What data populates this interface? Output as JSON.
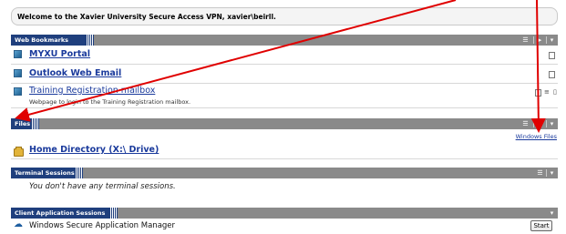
{
  "welcome": {
    "text": "Welcome to the Xavier University Secure Access VPN, xavier\\beirll."
  },
  "web_bookmarks": {
    "title": "Web Bookmarks",
    "items": [
      {
        "label": "MYXU Portal"
      },
      {
        "label": "Outlook Web Email"
      },
      {
        "label": "Training Registration mailbox",
        "description": "Webpage to login to the Training Registration mailbox."
      }
    ]
  },
  "files": {
    "title": "Files",
    "windows_files_link": "Windows Files",
    "items": [
      {
        "label": "Home Directory (X:\\ Drive)"
      }
    ]
  },
  "terminal_sessions": {
    "title": "Terminal Sessions",
    "empty_message": "You don't have any terminal sessions."
  },
  "client_app_sessions": {
    "title": "Client Application Sessions",
    "items": [
      {
        "label": "Windows Secure Application Manager",
        "button": "Start"
      }
    ]
  },
  "colors": {
    "header_tab": "#1f3f7d",
    "header_bar": "#8a8a8a",
    "link": "#1a3a9c",
    "annotation_arrow": "#e00000"
  },
  "icons": {
    "bookmark": "web-bookmark-icon",
    "folder": "folder-icon",
    "client_app": "application-manager-icon",
    "header_controls": [
      "list-menu-icon",
      "collapse-icon"
    ]
  }
}
